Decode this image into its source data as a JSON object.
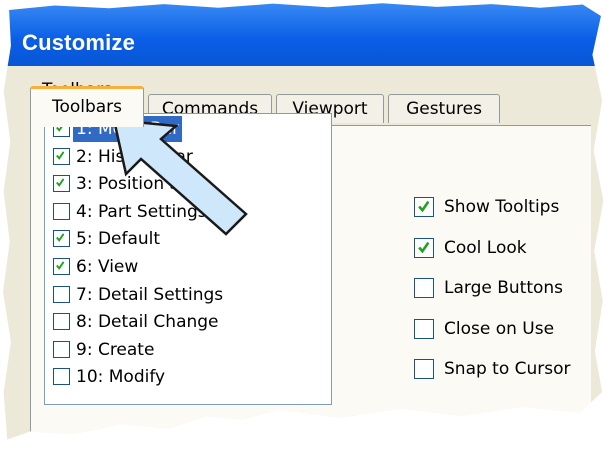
{
  "window": {
    "title": "Customize"
  },
  "tabs": [
    {
      "label": "Toolbars",
      "active": true
    },
    {
      "label": "Commands",
      "active": false
    },
    {
      "label": "Viewport",
      "active": false
    },
    {
      "label": "Gestures",
      "active": false
    }
  ],
  "toolbars_group": {
    "label": "Toolbars"
  },
  "toolbar_list": [
    {
      "label": "1: Menu Bar",
      "checked": true,
      "selected": true
    },
    {
      "label": "2: History Bar",
      "checked": true,
      "selected": false
    },
    {
      "label": "3: Position Snap",
      "checked": true,
      "selected": false
    },
    {
      "label": "4: Part Settings",
      "checked": false,
      "selected": false
    },
    {
      "label": "5: Default",
      "checked": true,
      "selected": false
    },
    {
      "label": "6: View",
      "checked": true,
      "selected": false
    },
    {
      "label": "7: Detail Settings",
      "checked": false,
      "selected": false
    },
    {
      "label": "8: Detail Change",
      "checked": false,
      "selected": false
    },
    {
      "label": "9: Create",
      "checked": false,
      "selected": false
    },
    {
      "label": "10: Modify",
      "checked": false,
      "selected": false
    }
  ],
  "options": [
    {
      "label": "Show Tooltips",
      "checked": true
    },
    {
      "label": "Cool Look",
      "checked": true
    },
    {
      "label": "Large Buttons",
      "checked": false
    },
    {
      "label": "Close on Use",
      "checked": false
    },
    {
      "label": "Snap to Cursor",
      "checked": false
    }
  ],
  "colors": {
    "titlebar": "#0a5ee6",
    "panel": "#ece9d8",
    "selection": "#316ac5",
    "check": "#21a121",
    "active_tab_accent": "#f9b03a",
    "callout_arrow": "#cfe7fb"
  },
  "icons": {
    "callout": "arrow-pointer-icon",
    "check": "check-mark-icon"
  }
}
